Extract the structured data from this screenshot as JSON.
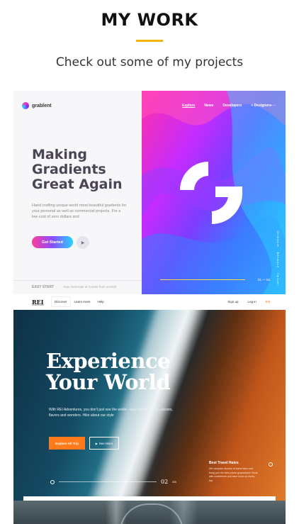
{
  "header": {
    "title": "MY WORK",
    "subtitle": "Check out some of my projects",
    "accent_color": "#f5b400"
  },
  "project1": {
    "logo": "grablent",
    "nav": [
      "Explore",
      "News",
      "Developers",
      "+ Designers"
    ],
    "heading": "Making Gradients Great Again",
    "description": "Hand crafting unique world most beautiful gradients for your personal as well as commercial projects. For a low cost of zero dollars and",
    "cta": "Get Started",
    "footer_label": "EASY START",
    "footer_note": "Auto-Generate or Create from scratch",
    "social": "Dribbble · Behance · Twitter",
    "pager": "01 — 03"
  },
  "project2": {
    "logo": "REI",
    "logo_sub": "ADVENTURES",
    "nav": [
      "Discover",
      "Learn more",
      "Help"
    ],
    "right_nav": [
      "Sign up",
      "Log in",
      "EN"
    ],
    "heading": "Experience Your World",
    "description": "With REI Adventures, you don't just see the world—you experience its cultures, flavors and wonders. Hike about our style",
    "explore_button": "Explore All Trip",
    "video_button": "See More",
    "page": "02",
    "total": "/05",
    "rates_title": "Best Travel Rates",
    "rates_text": "We compare dozens of travel sites and bring you the best prices guaranteed. Book with confidence and save more on every trip.",
    "accent_color": "#ff7a1a"
  }
}
